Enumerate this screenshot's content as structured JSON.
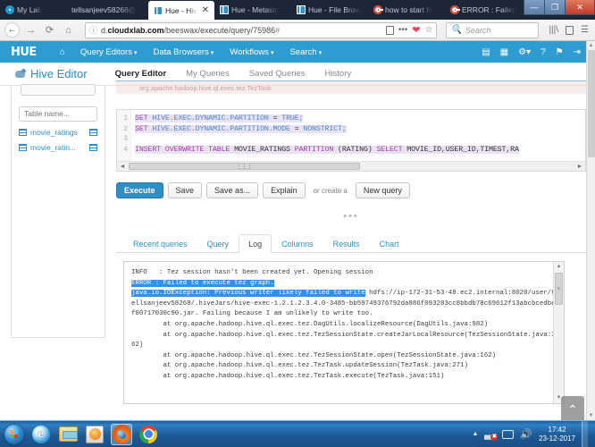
{
  "browser": {
    "tabs": [
      {
        "title": "My Lab",
        "favicon": "mylab-icon",
        "active": false
      },
      {
        "title": "tellsanjeev58268@i",
        "favicon": "none",
        "active": false
      },
      {
        "title": "Hue - Hive",
        "favicon": "hue-icon",
        "active": true
      },
      {
        "title": "Hue - Metasto",
        "favicon": "hue-icon",
        "active": false
      },
      {
        "title": "Hue - File Brow",
        "favicon": "hue-icon",
        "active": false
      },
      {
        "title": "how to start hi",
        "favicon": "google-icon",
        "active": false
      },
      {
        "title": "ERROR : Failed",
        "favicon": "google-icon",
        "active": false
      }
    ],
    "new_tab_label": "+",
    "close_tab_label": "✕",
    "window_controls": {
      "minimize": "—",
      "maximize": "❐",
      "close": "✕"
    },
    "nav": {
      "back": "←",
      "forward": "→",
      "reload": "⟳",
      "home": "⌂"
    },
    "url": {
      "domain_prefix": "d.",
      "domain_bold": "cloudxlab.com",
      "path": "/beeswax/execute/query/75986",
      "path_dim": "#",
      "info_icon": "ⓘ"
    },
    "search": {
      "placeholder": "Search",
      "icon": "search-icon"
    },
    "toolbar_icons": [
      "reader-view-icon",
      "page-actions-icon",
      "pocket-icon",
      "bookmark-star-icon",
      "library-icon",
      "sidebar-icon",
      "menu-icon"
    ]
  },
  "hue": {
    "logo": "ᕼUE",
    "home_icon": "home-icon",
    "menu": [
      {
        "label": "Query Editors",
        "caret": "▾"
      },
      {
        "label": "Data Browsers",
        "caret": "▾"
      },
      {
        "label": "Workflows",
        "caret": "▾"
      },
      {
        "label": "Search",
        "caret": "▾"
      }
    ],
    "right_icons": [
      "document-icon",
      "jobs-icon",
      "settings-gear-icon",
      "help-icon",
      "notification-flag-icon",
      "logout-icon"
    ]
  },
  "editor": {
    "app_title": "Hive Editor",
    "app_icon": "hive-elephant-icon",
    "tabs": [
      {
        "label": "Query Editor",
        "active": true
      },
      {
        "label": "My Queries",
        "active": false
      },
      {
        "label": "Saved Queries",
        "active": false
      },
      {
        "label": "History",
        "active": false
      }
    ]
  },
  "sidebar": {
    "table_filter_placeholder": "Table name...",
    "tables": [
      {
        "label": "movie_ratings",
        "icon": "table-icon",
        "action_icon": "columns-icon"
      },
      {
        "label": "movie_ratin...",
        "icon": "table-icon",
        "action_icon": "columns-icon"
      }
    ]
  },
  "query": {
    "error_banner_text": "org.apache.hadoop.hive.ql.exec.tez.TezTask",
    "lines": [
      {
        "no": "1",
        "segments": [
          {
            "t": "SET",
            "c": "k"
          },
          {
            "t": " ",
            "c": "p"
          },
          {
            "t": "HIVE.EXEC.DYNAMIC.PARTITION",
            "c": "n"
          },
          {
            "t": " = ",
            "c": "p"
          },
          {
            "t": "TRUE;",
            "c": "n"
          }
        ]
      },
      {
        "no": "2",
        "segments": [
          {
            "t": "SET",
            "c": "k"
          },
          {
            "t": " ",
            "c": "p"
          },
          {
            "t": "HIVE.EXEC.DYNAMIC.PARTITION.MODE",
            "c": "n"
          },
          {
            "t": " = ",
            "c": "p"
          },
          {
            "t": "NONSTRICT;",
            "c": "n"
          }
        ]
      },
      {
        "no": "3",
        "segments": []
      },
      {
        "no": "4",
        "segments": [
          {
            "t": "INSERT OVERWRITE TABLE",
            "c": "k"
          },
          {
            "t": " MOVIE_RATINGS ",
            "c": "p"
          },
          {
            "t": "PARTITION",
            "c": "k"
          },
          {
            "t": " (RATING) ",
            "c": "p"
          },
          {
            "t": "SELECT",
            "c": "k"
          },
          {
            "t": " MOVIE_ID,USER_ID,TIMEST,RA",
            "c": "p"
          }
        ]
      }
    ],
    "hscroll": {
      "left": "◄",
      "right": "►",
      "grip": "⋮⋮⋮"
    }
  },
  "actions": {
    "execute": "Execute",
    "save": "Save",
    "save_as": "Save as...",
    "explain": "Explain",
    "or_create": "or create a",
    "new_query": "New query",
    "dots": "•••"
  },
  "results": {
    "tabs": [
      {
        "label": "Recent queries",
        "active": false
      },
      {
        "label": "Query",
        "active": false
      },
      {
        "label": "Log",
        "active": true
      },
      {
        "label": "Columns",
        "active": false
      },
      {
        "label": "Results",
        "active": false
      },
      {
        "label": "Chart",
        "active": false
      }
    ],
    "log": {
      "line_info": "INFO   : Tez session hasn't been created yet. Opening session",
      "line_error": "ERROR : Failed to execute tez graph.",
      "line_exception_selected": "java.io.IOException: Previous writer likely failed to write",
      "line_exception_rest": " hdfs://ip-172-31-53-48.ec2.internal:8020/user/tellsanjeev58268/.hiveJars/hive-exec-1.2.1.2.3.4.0-3485-bb59749376792da886f093283cc8bbdb78c69612f13abcbcedbef00717030c90.jar. Failing because I am unlikely to write too.",
      "stack": [
        "        at org.apache.hadoop.hive.ql.exec.tez.DagUtils.localizeResource(DagUtils.java:982)",
        "        at org.apache.hadoop.hive.ql.exec.tez.TezSessionState.createJarLocalResource(TezSessionState.java:362)",
        "        at org.apache.hadoop.hive.ql.exec.tez.TezSessionState.open(TezSessionState.java:162)",
        "        at org.apache.hadoop.hive.ql.exec.tez.TezTask.updateSession(TezTask.java:271)",
        "        at org.apache.hadoop.hive.ql.exec.tez.TezTask.execute(TezTask.java:151)"
      ],
      "scroll_up": "▲",
      "scroll_down": "▼",
      "scroll_thumb_label": "≡",
      "back_to_top_icon": "chevron-up-icon"
    }
  },
  "taskbar": {
    "items": [
      {
        "name": "start-button",
        "icon": "windows-start-icon",
        "active": false
      },
      {
        "name": "internet-explorer",
        "icon": "internet-explorer-icon",
        "active": false
      },
      {
        "name": "file-explorer",
        "icon": "folder-icon",
        "active": false
      },
      {
        "name": "media-player",
        "icon": "media-player-icon",
        "active": false
      },
      {
        "name": "firefox",
        "icon": "firefox-icon",
        "active": true
      },
      {
        "name": "chrome",
        "icon": "chrome-icon",
        "active": false
      }
    ],
    "tray": {
      "expand": "▲",
      "network_icon": "network-error-icon",
      "monitor_icon": "monitor-icon",
      "volume_icon": "🔊",
      "time": "17:42",
      "date": "23-12-2017"
    }
  }
}
